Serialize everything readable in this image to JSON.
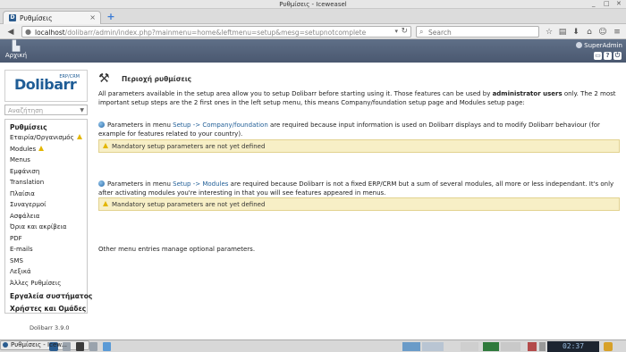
{
  "window": {
    "title": "Ρυθμίσεις - Iceweasel"
  },
  "browser": {
    "tab": {
      "label": "Ρυθμίσεις",
      "favicon": "D"
    },
    "url_host": "localhost",
    "url_path": "/dolibarr/admin/index.php?mainmenu=home&leftmenu=setup&mesg=setupnotcomplete",
    "search_placeholder": "Search"
  },
  "topbar": {
    "home_label": "Αρχική",
    "user": "SuperAdmin"
  },
  "sidebar": {
    "logo_text": "Dolibarr",
    "logo_sub": "ERP/CRM",
    "search_placeholder": "Αναζήτηση",
    "heading": "Ρυθμίσεις",
    "items": [
      {
        "label": "Εταιρία/Οργανισμός",
        "warn": true
      },
      {
        "label": "Modules",
        "warn": true
      },
      {
        "label": "Menus"
      },
      {
        "label": "Εμφάνιση"
      },
      {
        "label": "Translation"
      },
      {
        "label": "Πλαίσια"
      },
      {
        "label": "Συναγερμοί"
      },
      {
        "label": "Ασφάλεια"
      },
      {
        "label": "Όρια και ακρίβεια"
      },
      {
        "label": "PDF"
      },
      {
        "label": "E-mails"
      },
      {
        "label": "SMS"
      },
      {
        "label": "Λεξικά"
      },
      {
        "label": "Άλλες Ρυθμίσεις"
      }
    ],
    "section_tools": "Εργαλεία συστήματος",
    "section_users": "Χρήστες και Ομάδες",
    "version": "Dolibarr 3.9.0"
  },
  "main": {
    "title": "Περιοχή ρυθμίσεις",
    "intro_before": "All parameters available in the setup area allow you to setup Dolibarr before starting using it. Those features can be used by ",
    "intro_bold": "administrator users",
    "intro_after": " only. The 2 most important setup steps are the 2 first ones in the left setup menu, this means Company/foundation setup page and Modules setup page:",
    "company_before": "Parameters in menu ",
    "company_link": "Setup -> Company/foundation",
    "company_after": " are required because input information is used on Dolibarr displays and to modify Dolibarr behaviour (for example for features related to your country).",
    "warn1": "Mandatory setup parameters are not yet defined",
    "modules_before": "Parameters in menu ",
    "modules_link": "Setup -> Modules",
    "modules_after": " are required because Dolibarr is not a fixed ERP/CRM but a sum of several modules, all more or less independant. It's only after activating modules you're interesting in that you will see features appeared in menus.",
    "warn2": "Mandatory setup parameters are not yet defined",
    "other": "Other menu entries manage optional parameters."
  },
  "taskbar": {
    "task_label": "Ρυθμίσεις - Icew...",
    "clock": "02:37"
  }
}
